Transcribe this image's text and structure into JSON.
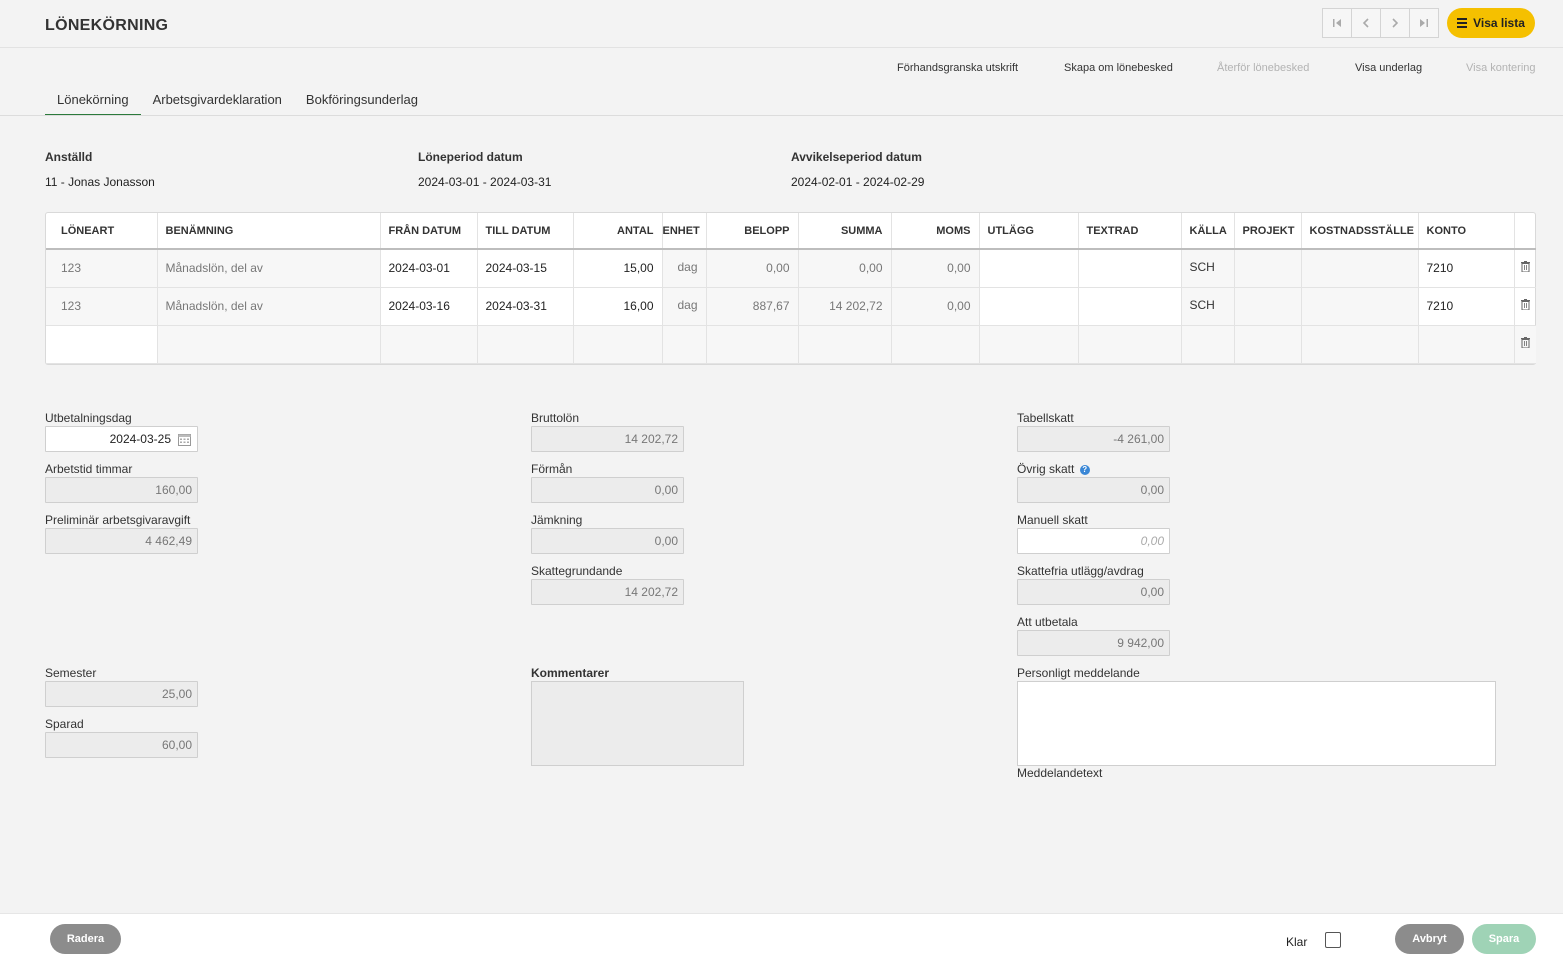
{
  "page": {
    "title": "LÖNEKÖRNING"
  },
  "nav": {
    "visa_lista": "Visa lista"
  },
  "actions": {
    "preview_print": "Förhandsgranska utskrift",
    "recreate": "Skapa om lönebesked",
    "revert": "Återför lönebesked",
    "show_basis": "Visa underlag",
    "show_posting": "Visa kontering"
  },
  "tabs": [
    "Lönekörning",
    "Arbetsgivardeklaration",
    "Bokföringsunderlag"
  ],
  "info": {
    "employee_label": "Anställd",
    "employee_value": "11 - Jonas Jonasson",
    "period_label": "Löneperiod datum",
    "period_value": "2024-03-01 - 2024-03-31",
    "deviation_label": "Avvikelseperiod datum",
    "deviation_value": "2024-02-01 - 2024-02-29"
  },
  "grid": {
    "headers": [
      "LÖNEART",
      "BENÄMNING",
      "FRÅN DATUM",
      "TILL DATUM",
      "ANTAL",
      "ENHET",
      "BELOPP",
      "SUMMA",
      "MOMS",
      "UTLÄGG",
      "TEXTRAD",
      "KÄLLA",
      "PROJEKT",
      "KOSTNADSSTÄLLE",
      "KONTO"
    ],
    "rows": [
      {
        "loneart": "123",
        "benamning": "Månadslön, del av",
        "fran": "2024-03-01",
        "till": "2024-03-15",
        "antal": "15,00",
        "enhet": "dag",
        "belopp": "0,00",
        "summa": "0,00",
        "moms": "0,00",
        "utlagg": "",
        "textrad": "",
        "kalla": "SCH",
        "projekt": "",
        "kostnadsstalle": "",
        "konto": "7210"
      },
      {
        "loneart": "123",
        "benamning": "Månadslön, del av",
        "fran": "2024-03-16",
        "till": "2024-03-31",
        "antal": "16,00",
        "enhet": "dag",
        "belopp": "887,67",
        "summa": "14 202,72",
        "moms": "0,00",
        "utlagg": "",
        "textrad": "",
        "kalla": "SCH",
        "projekt": "",
        "kostnadsstalle": "",
        "konto": "7210"
      }
    ]
  },
  "col1": {
    "utbetalningsdag_label": "Utbetalningsdag",
    "utbetalningsdag": "2024-03-25",
    "arbetstid_label": "Arbetstid timmar",
    "arbetstid": "160,00",
    "prelim_label": "Preliminär arbetsgivaravgift",
    "prelim": "4 462,49",
    "semester_label": "Semester",
    "semester": "25,00",
    "sparad_label": "Sparad",
    "sparad": "60,00"
  },
  "col2": {
    "brutto_label": "Bruttolön",
    "brutto": "14 202,72",
    "forman_label": "Förmån",
    "forman": "0,00",
    "jamkning_label": "Jämkning",
    "jamkning": "0,00",
    "skattegrundande_label": "Skattegrundande",
    "skattegrundande": "14 202,72",
    "kommentarer_label": "Kommentarer"
  },
  "col3": {
    "tabellskatt_label": "Tabellskatt",
    "tabellskatt": "-4 261,00",
    "ovrig_label": "Övrig skatt",
    "ovrig": "0,00",
    "manuell_label": "Manuell skatt",
    "manuell_placeholder": "0,00",
    "skattefria_label": "Skattefria utlägg/avdrag",
    "skattefria": "0,00",
    "att_utbetala_label": "Att utbetala",
    "att_utbetala": "9 942,00",
    "personligt_label": "Personligt meddelande",
    "meddelandetext": "Meddelandetext"
  },
  "footer": {
    "radera": "Radera",
    "klar": "Klar",
    "avbryt": "Avbryt",
    "spara": "Spara"
  },
  "colors": {
    "accent": "#f5c000",
    "tab_active": "#2b7a3b",
    "pill_gray": "#8c8c8c",
    "spara": "#9fd3b6",
    "help": "#3a87d6"
  },
  "icons": [
    "first-page-icon",
    "prev-icon",
    "next-icon",
    "last-page-icon",
    "hamburger-icon",
    "trash-icon",
    "calendar-icon",
    "help-icon"
  ]
}
